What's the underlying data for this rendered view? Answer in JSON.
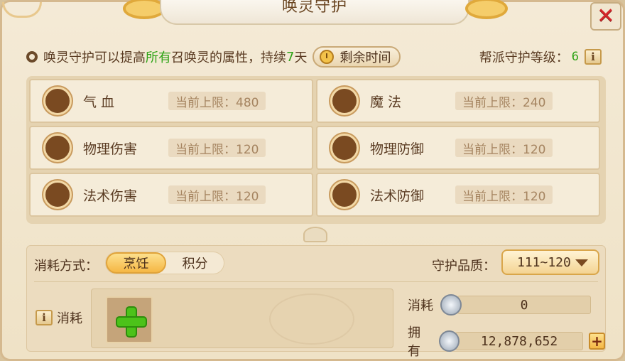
{
  "window": {
    "title": "唤灵守护",
    "close_symbol": "✕"
  },
  "info": {
    "text_before": "唤灵守护可以提高",
    "highlight": "所有",
    "text_middle": "召唤灵的属性，持续",
    "duration": "7",
    "text_after": "天",
    "timer_button": "剩余时间",
    "guard_level_label": "帮派守护等级：",
    "guard_level_value": "6",
    "info_symbol": "i"
  },
  "attributes": [
    {
      "name": "气    血",
      "limit": "当前上限：480"
    },
    {
      "name": "魔    法",
      "limit": "当前上限：240"
    },
    {
      "name": "物理伤害",
      "limit": "当前上限：120"
    },
    {
      "name": "物理防御",
      "limit": "当前上限：120"
    },
    {
      "name": "法术伤害",
      "limit": "当前上限：120"
    },
    {
      "name": "法术防御",
      "limit": "当前上限：120"
    }
  ],
  "consume": {
    "method_label": "消耗方式：",
    "options": [
      "烹饪",
      "积分"
    ],
    "selected": "烹饪",
    "quality_label": "守护品质：",
    "quality_value": "111~120",
    "consume_info_label": "消耗",
    "cost_label": "消耗",
    "cost_value": "0",
    "owned_label": "拥有",
    "owned_value": "12,878,652",
    "add_symbol": "+"
  },
  "colors": {
    "accent_green": "#2ea316",
    "title_gold": "#e0a93b",
    "close_red": "#d6262b"
  }
}
